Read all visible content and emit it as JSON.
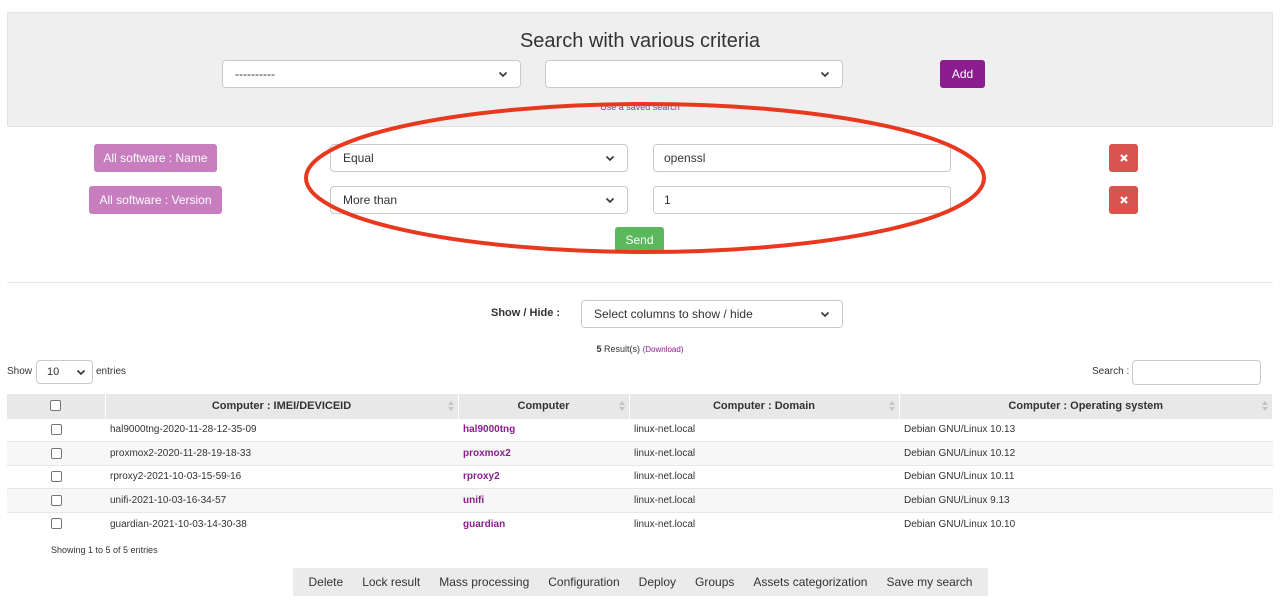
{
  "search": {
    "title": "Search with various criteria",
    "field_select_value": "----------",
    "table_select_value": "",
    "add_label": "Add",
    "saved_search_link": "Use a saved search"
  },
  "criteria": [
    {
      "label": "All software : Name",
      "operator": "Equal",
      "value": "openssl"
    },
    {
      "label": "All software : Version",
      "operator": "More than",
      "value": "1"
    }
  ],
  "send_label": "Send",
  "show_hide": {
    "label": "Show / Hide :",
    "placeholder": "Select columns to show / hide"
  },
  "results": {
    "count": "5",
    "suffix": "Result(s)",
    "download_label": "(Download)"
  },
  "length_control": {
    "show_label": "Show",
    "value": "10",
    "entries_label": "entries"
  },
  "table_search_label": "Search :",
  "table": {
    "columns": [
      "Computer : IMEI/DEVICEID",
      "Computer",
      "Computer : Domain",
      "Computer : Operating system"
    ],
    "rows": [
      {
        "imei": "hal9000tng-2020-11-28-12-35-09",
        "computer": "hal9000tng",
        "domain": "linux-net.local",
        "os": "Debian GNU/Linux 10.13"
      },
      {
        "imei": "proxmox2-2020-11-28-19-18-33",
        "computer": "proxmox2",
        "domain": "linux-net.local",
        "os": "Debian GNU/Linux 10.12"
      },
      {
        "imei": "rproxy2-2021-10-03-15-59-16",
        "computer": "rproxy2",
        "domain": "linux-net.local",
        "os": "Debian GNU/Linux 10.11"
      },
      {
        "imei": "unifi-2021-10-03-16-34-57",
        "computer": "unifi",
        "domain": "linux-net.local",
        "os": "Debian GNU/Linux 9.13"
      },
      {
        "imei": "guardian-2021-10-03-14-30-38",
        "computer": "guardian",
        "domain": "linux-net.local",
        "os": "Debian GNU/Linux 10.10"
      }
    ]
  },
  "showing_info": "Showing 1 to 5 of 5 entries",
  "actions": [
    "Delete",
    "Lock result",
    "Mass processing",
    "Configuration",
    "Deploy",
    "Groups",
    "Assets categorization",
    "Save my search"
  ],
  "colors": {
    "accent_purple": "#8b1d8f",
    "criteria_label": "#c77dbe",
    "danger": "#d9534f",
    "success": "#5cb85c",
    "annotation": "#e8391f"
  }
}
